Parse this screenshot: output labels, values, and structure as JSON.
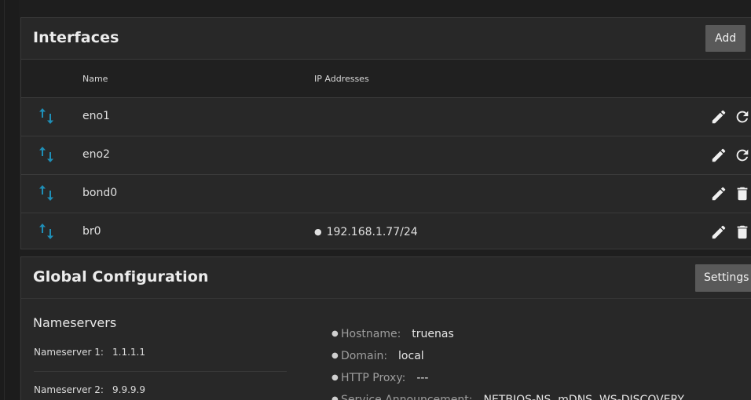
{
  "interfaces": {
    "title": "Interfaces",
    "add_label": "Add",
    "columns": {
      "name": "Name",
      "ip": "IP Addresses"
    },
    "rows": [
      {
        "name": "eno1",
        "ip": "",
        "actions": [
          "edit",
          "reset"
        ]
      },
      {
        "name": "eno2",
        "ip": "",
        "actions": [
          "edit",
          "reset"
        ]
      },
      {
        "name": "bond0",
        "ip": "",
        "actions": [
          "edit",
          "delete"
        ]
      },
      {
        "name": "br0",
        "ip": "192.168.1.77/24",
        "actions": [
          "edit",
          "delete"
        ]
      }
    ]
  },
  "global": {
    "title": "Global Configuration",
    "settings_label": "Settings",
    "nameservers": {
      "title": "Nameservers",
      "items": [
        {
          "label": "Nameserver 1:",
          "value": "1.1.1.1"
        },
        {
          "label": "Nameserver 2:",
          "value": "9.9.9.9"
        }
      ]
    },
    "details": [
      {
        "key": "Hostname:",
        "value": "truenas"
      },
      {
        "key": "Domain:",
        "value": "local"
      },
      {
        "key": "HTTP Proxy:",
        "value": "---"
      },
      {
        "key": "Service Announcement:",
        "value": "NETBIOS-NS, mDNS, WS-DISCOVERY"
      }
    ]
  },
  "colors": {
    "background": "#1e1e1e",
    "card": "#282828",
    "table_header": "#202020",
    "button": "#595959",
    "interface_icon": "#1f8fb7"
  },
  "icons": {
    "interface": "swap-vertical-icon",
    "edit": "pencil-icon",
    "reset": "refresh-icon",
    "delete": "trash-icon"
  }
}
